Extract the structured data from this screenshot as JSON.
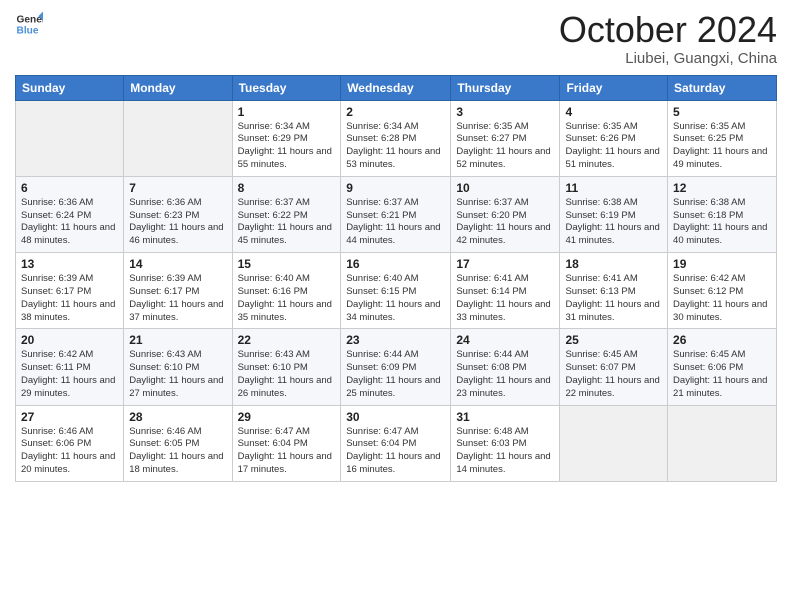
{
  "header": {
    "logo_line1": "General",
    "logo_line2": "Blue",
    "title": "October 2024",
    "location": "Liubei, Guangxi, China"
  },
  "weekdays": [
    "Sunday",
    "Monday",
    "Tuesday",
    "Wednesday",
    "Thursday",
    "Friday",
    "Saturday"
  ],
  "weeks": [
    [
      {
        "day": "",
        "sunrise": "",
        "sunset": "",
        "daylight": ""
      },
      {
        "day": "",
        "sunrise": "",
        "sunset": "",
        "daylight": ""
      },
      {
        "day": "1",
        "sunrise": "Sunrise: 6:34 AM",
        "sunset": "Sunset: 6:29 PM",
        "daylight": "Daylight: 11 hours and 55 minutes."
      },
      {
        "day": "2",
        "sunrise": "Sunrise: 6:34 AM",
        "sunset": "Sunset: 6:28 PM",
        "daylight": "Daylight: 11 hours and 53 minutes."
      },
      {
        "day": "3",
        "sunrise": "Sunrise: 6:35 AM",
        "sunset": "Sunset: 6:27 PM",
        "daylight": "Daylight: 11 hours and 52 minutes."
      },
      {
        "day": "4",
        "sunrise": "Sunrise: 6:35 AM",
        "sunset": "Sunset: 6:26 PM",
        "daylight": "Daylight: 11 hours and 51 minutes."
      },
      {
        "day": "5",
        "sunrise": "Sunrise: 6:35 AM",
        "sunset": "Sunset: 6:25 PM",
        "daylight": "Daylight: 11 hours and 49 minutes."
      }
    ],
    [
      {
        "day": "6",
        "sunrise": "Sunrise: 6:36 AM",
        "sunset": "Sunset: 6:24 PM",
        "daylight": "Daylight: 11 hours and 48 minutes."
      },
      {
        "day": "7",
        "sunrise": "Sunrise: 6:36 AM",
        "sunset": "Sunset: 6:23 PM",
        "daylight": "Daylight: 11 hours and 46 minutes."
      },
      {
        "day": "8",
        "sunrise": "Sunrise: 6:37 AM",
        "sunset": "Sunset: 6:22 PM",
        "daylight": "Daylight: 11 hours and 45 minutes."
      },
      {
        "day": "9",
        "sunrise": "Sunrise: 6:37 AM",
        "sunset": "Sunset: 6:21 PM",
        "daylight": "Daylight: 11 hours and 44 minutes."
      },
      {
        "day": "10",
        "sunrise": "Sunrise: 6:37 AM",
        "sunset": "Sunset: 6:20 PM",
        "daylight": "Daylight: 11 hours and 42 minutes."
      },
      {
        "day": "11",
        "sunrise": "Sunrise: 6:38 AM",
        "sunset": "Sunset: 6:19 PM",
        "daylight": "Daylight: 11 hours and 41 minutes."
      },
      {
        "day": "12",
        "sunrise": "Sunrise: 6:38 AM",
        "sunset": "Sunset: 6:18 PM",
        "daylight": "Daylight: 11 hours and 40 minutes."
      }
    ],
    [
      {
        "day": "13",
        "sunrise": "Sunrise: 6:39 AM",
        "sunset": "Sunset: 6:17 PM",
        "daylight": "Daylight: 11 hours and 38 minutes."
      },
      {
        "day": "14",
        "sunrise": "Sunrise: 6:39 AM",
        "sunset": "Sunset: 6:17 PM",
        "daylight": "Daylight: 11 hours and 37 minutes."
      },
      {
        "day": "15",
        "sunrise": "Sunrise: 6:40 AM",
        "sunset": "Sunset: 6:16 PM",
        "daylight": "Daylight: 11 hours and 35 minutes."
      },
      {
        "day": "16",
        "sunrise": "Sunrise: 6:40 AM",
        "sunset": "Sunset: 6:15 PM",
        "daylight": "Daylight: 11 hours and 34 minutes."
      },
      {
        "day": "17",
        "sunrise": "Sunrise: 6:41 AM",
        "sunset": "Sunset: 6:14 PM",
        "daylight": "Daylight: 11 hours and 33 minutes."
      },
      {
        "day": "18",
        "sunrise": "Sunrise: 6:41 AM",
        "sunset": "Sunset: 6:13 PM",
        "daylight": "Daylight: 11 hours and 31 minutes."
      },
      {
        "day": "19",
        "sunrise": "Sunrise: 6:42 AM",
        "sunset": "Sunset: 6:12 PM",
        "daylight": "Daylight: 11 hours and 30 minutes."
      }
    ],
    [
      {
        "day": "20",
        "sunrise": "Sunrise: 6:42 AM",
        "sunset": "Sunset: 6:11 PM",
        "daylight": "Daylight: 11 hours and 29 minutes."
      },
      {
        "day": "21",
        "sunrise": "Sunrise: 6:43 AM",
        "sunset": "Sunset: 6:10 PM",
        "daylight": "Daylight: 11 hours and 27 minutes."
      },
      {
        "day": "22",
        "sunrise": "Sunrise: 6:43 AM",
        "sunset": "Sunset: 6:10 PM",
        "daylight": "Daylight: 11 hours and 26 minutes."
      },
      {
        "day": "23",
        "sunrise": "Sunrise: 6:44 AM",
        "sunset": "Sunset: 6:09 PM",
        "daylight": "Daylight: 11 hours and 25 minutes."
      },
      {
        "day": "24",
        "sunrise": "Sunrise: 6:44 AM",
        "sunset": "Sunset: 6:08 PM",
        "daylight": "Daylight: 11 hours and 23 minutes."
      },
      {
        "day": "25",
        "sunrise": "Sunrise: 6:45 AM",
        "sunset": "Sunset: 6:07 PM",
        "daylight": "Daylight: 11 hours and 22 minutes."
      },
      {
        "day": "26",
        "sunrise": "Sunrise: 6:45 AM",
        "sunset": "Sunset: 6:06 PM",
        "daylight": "Daylight: 11 hours and 21 minutes."
      }
    ],
    [
      {
        "day": "27",
        "sunrise": "Sunrise: 6:46 AM",
        "sunset": "Sunset: 6:06 PM",
        "daylight": "Daylight: 11 hours and 20 minutes."
      },
      {
        "day": "28",
        "sunrise": "Sunrise: 6:46 AM",
        "sunset": "Sunset: 6:05 PM",
        "daylight": "Daylight: 11 hours and 18 minutes."
      },
      {
        "day": "29",
        "sunrise": "Sunrise: 6:47 AM",
        "sunset": "Sunset: 6:04 PM",
        "daylight": "Daylight: 11 hours and 17 minutes."
      },
      {
        "day": "30",
        "sunrise": "Sunrise: 6:47 AM",
        "sunset": "Sunset: 6:04 PM",
        "daylight": "Daylight: 11 hours and 16 minutes."
      },
      {
        "day": "31",
        "sunrise": "Sunrise: 6:48 AM",
        "sunset": "Sunset: 6:03 PM",
        "daylight": "Daylight: 11 hours and 14 minutes."
      },
      {
        "day": "",
        "sunrise": "",
        "sunset": "",
        "daylight": ""
      },
      {
        "day": "",
        "sunrise": "",
        "sunset": "",
        "daylight": ""
      }
    ]
  ]
}
